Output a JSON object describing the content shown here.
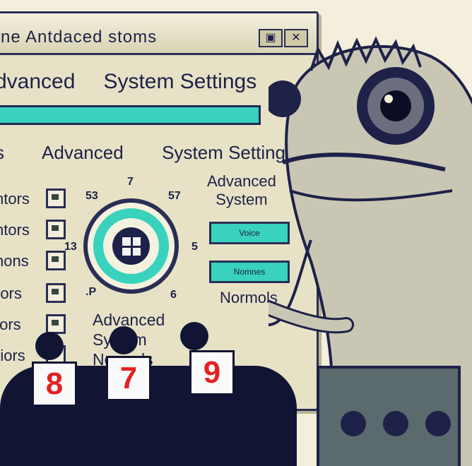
{
  "window": {
    "title": "ne Antdaced  stoms",
    "heading1_left": "dvanced",
    "heading1_right": "System Settings",
    "heading2_left": "s",
    "heading2_mid": "Advanced",
    "heading2_right": "System Settings",
    "rows": [
      "ntors",
      "ntors",
      "nons",
      "rors",
      "tors",
      "riors"
    ],
    "dial_ticks": {
      "top": "7",
      "top_left": "53",
      "top_right": "57",
      "left": "13",
      "right": "5",
      "bottom_left": ".P",
      "bottom_right": "6"
    },
    "side_heading_line1": "Advanced",
    "side_heading_line2": "System",
    "pill1": "Voice",
    "pill2": "Nomnes",
    "side_footer": "Normols",
    "middle_line1": "Advanced",
    "middle_line2": "System",
    "middle_line3": "Normols"
  },
  "score_cards": [
    "8",
    "7",
    "9"
  ],
  "colors": {
    "accent": "#39d2bd",
    "ink": "#1e2148",
    "paper": "#f3efdc",
    "card_digit": "#e32121"
  }
}
